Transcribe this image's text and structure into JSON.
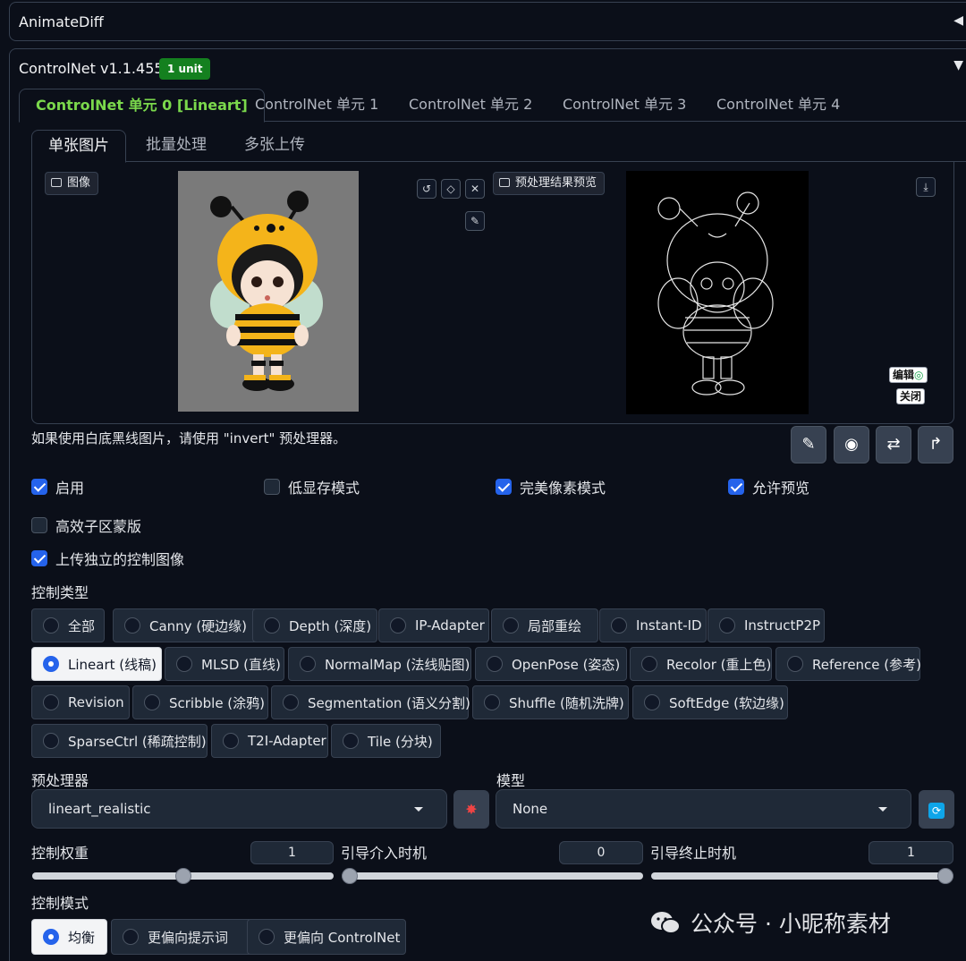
{
  "accordions": {
    "animatediff": {
      "title": "AnimateDiff",
      "arrow": "◀"
    },
    "controlnet": {
      "title": "ControlNet v1.1.455",
      "badge": "1 unit",
      "arrow": "▼"
    }
  },
  "unit_tabs": [
    {
      "label": "ControlNet 单元 0 [Lineart]",
      "active": true
    },
    {
      "label": "ControlNet 单元 1"
    },
    {
      "label": "ControlNet 单元 2"
    },
    {
      "label": "ControlNet 单元 3"
    },
    {
      "label": "ControlNet 单元 4"
    }
  ],
  "sub_tabs": [
    {
      "label": "单张图片",
      "active": true
    },
    {
      "label": "批量处理"
    },
    {
      "label": "多张上传"
    }
  ],
  "image_panel": {
    "source_label": "图像",
    "preview_label": "预处理结果预览",
    "edit_label": "编辑",
    "close_label": "关闭"
  },
  "hint": "如果使用白底黑线图片，请使用 \"invert\" 预处理器。",
  "checkboxes": {
    "enable": {
      "label": "启用",
      "checked": true
    },
    "low_vram": {
      "label": "低显存模式",
      "checked": false
    },
    "pixel_perfect": {
      "label": "完美像素模式",
      "checked": true
    },
    "allow_preview": {
      "label": "允许预览",
      "checked": true
    },
    "efficient_mask": {
      "label": "高效子区蒙版",
      "checked": false
    },
    "upload_independent": {
      "label": "上传独立的控制图像",
      "checked": true
    }
  },
  "control_type": {
    "label": "控制类型",
    "options": [
      "全部",
      "Canny (硬边缘)",
      "Depth (深度)",
      "IP-Adapter",
      "局部重绘",
      "Instant-ID",
      "InstructP2P",
      "Lineart (线稿)",
      "MLSD (直线)",
      "NormalMap (法线贴图)",
      "OpenPose (姿态)",
      "Recolor (重上色)",
      "Reference (参考)",
      "Revision",
      "Scribble (涂鸦)",
      "Segmentation (语义分割)",
      "Shuffle (随机洗牌)",
      "SoftEdge (软边缘)",
      "SparseCtrl (稀疏控制)",
      "T2I-Adapter",
      "Tile (分块)"
    ],
    "selected": "Lineart (线稿)"
  },
  "preprocessor": {
    "label": "预处理器",
    "value": "lineart_realistic"
  },
  "model": {
    "label": "模型",
    "value": "None"
  },
  "sliders": {
    "weight": {
      "label": "控制权重",
      "value": "1",
      "fraction": 0.5
    },
    "start": {
      "label": "引导介入时机",
      "value": "0",
      "fraction": 0.0
    },
    "end": {
      "label": "引导终止时机",
      "value": "1",
      "fraction": 1.0
    }
  },
  "control_mode": {
    "label": "控制模式",
    "options": [
      "均衡",
      "更偏向提示词",
      "更偏向 ControlNet"
    ],
    "selected": "均衡"
  },
  "watermark": "公众号 · 小昵称素材"
}
